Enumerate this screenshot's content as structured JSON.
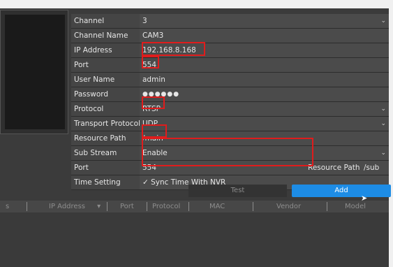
{
  "form": {
    "channel": {
      "label": "Channel",
      "value": "3"
    },
    "channel_name": {
      "label": "Channel Name",
      "value": "CAM3"
    },
    "ip_address": {
      "label": "IP Address",
      "value": "192.168.8.168"
    },
    "port": {
      "label": "Port",
      "value": "554"
    },
    "user_name": {
      "label": "User Name",
      "value": "admin"
    },
    "password": {
      "label": "Password",
      "value": "●●●●●●"
    },
    "protocol": {
      "label": "Protocol",
      "value": "RTSP"
    },
    "transport_protocol": {
      "label": "Transport Protocol",
      "value": "UDP"
    },
    "resource_path": {
      "label": "Resource Path",
      "value": "/main"
    },
    "sub_stream": {
      "label": "Sub Stream",
      "value": "Enable"
    },
    "sub_port": {
      "label": "Port",
      "value": "554",
      "resource_path_label": "Resource Path",
      "resource_path_value": "/sub"
    },
    "time_setting": {
      "label": "Time Setting",
      "value": "✓ Sync Time With NVR"
    }
  },
  "buttons": {
    "test": "Test",
    "add": "Add"
  },
  "table": {
    "columns": [
      "s",
      "IP Address",
      "Port",
      "Protocol",
      "MAC",
      "Vendor",
      "Model"
    ],
    "sort_indicator": "▾"
  },
  "icons": {
    "dropdown": "chevron-down-icon",
    "checkbox": "check-icon",
    "cursor": "mouse-pointer-icon"
  },
  "colors": {
    "highlight": "#e01c1c",
    "accent": "#1d8ce5"
  }
}
